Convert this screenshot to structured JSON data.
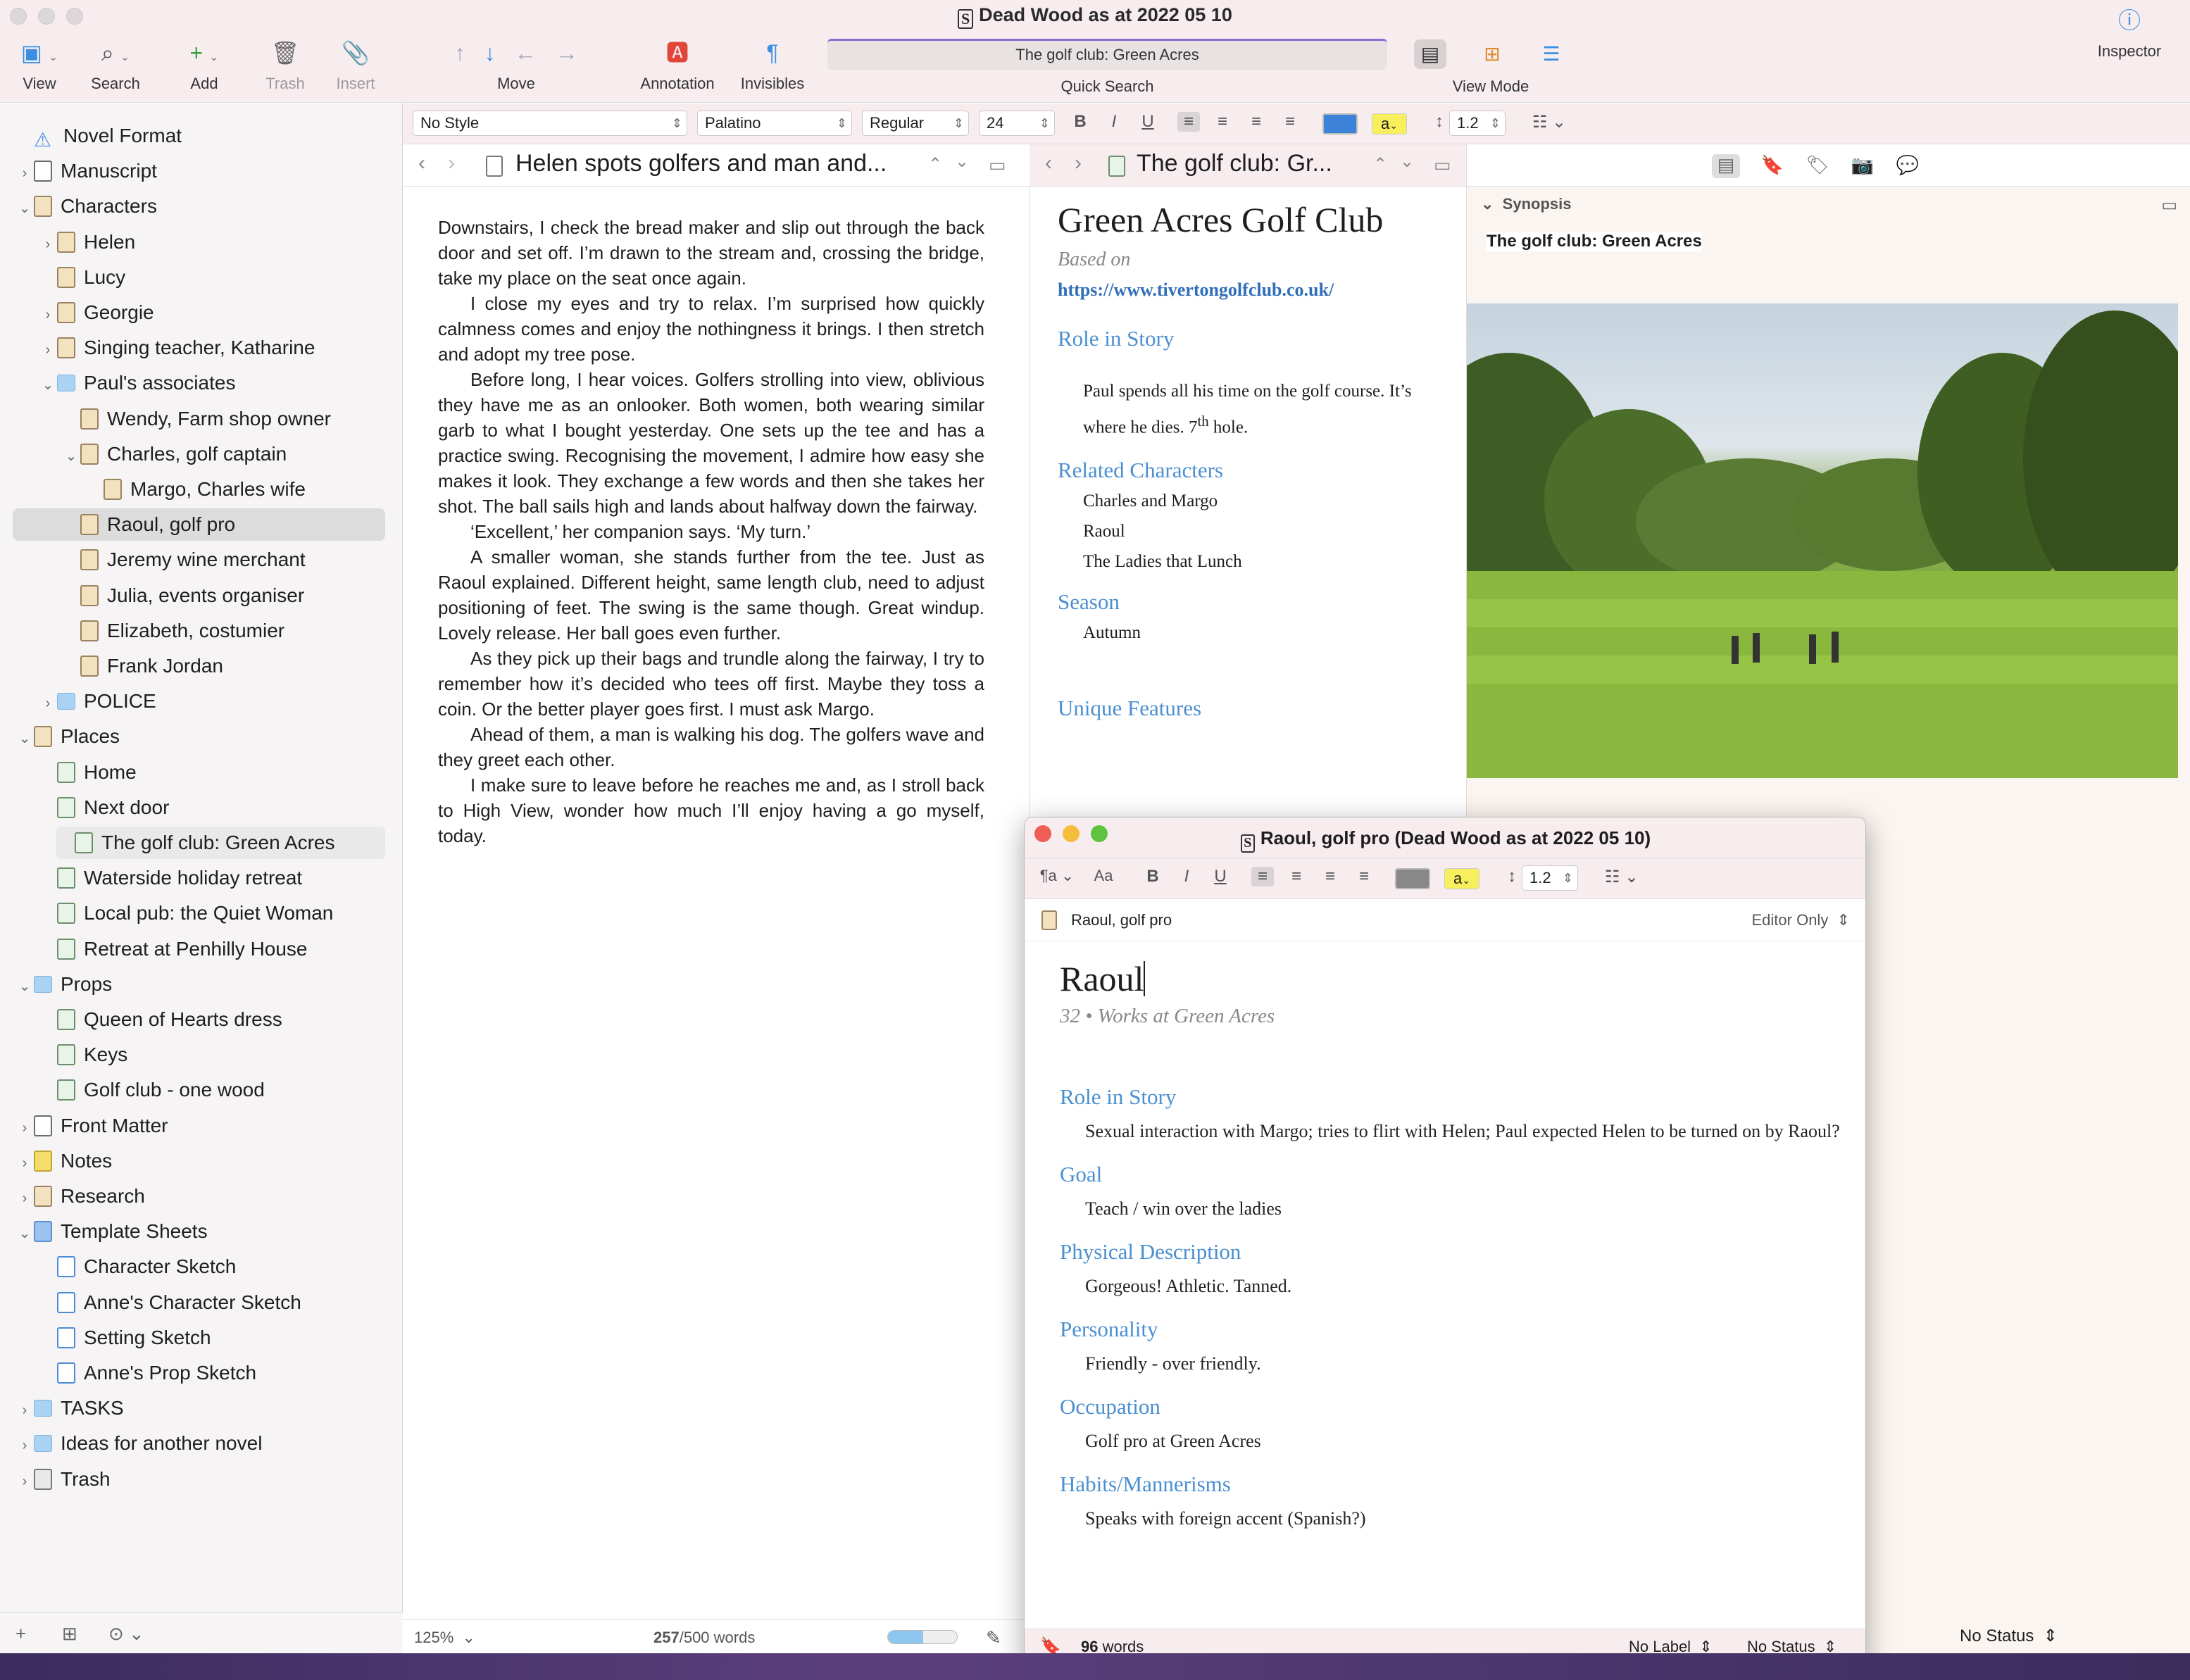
{
  "window": {
    "title": "Dead Wood as at 2022 05 10"
  },
  "toolbar": {
    "view": "View",
    "search": "Search",
    "add": "Add",
    "trash": "Trash",
    "insert": "Insert",
    "move": "Move",
    "annotation": "Annotation",
    "invisibles": "Invisibles",
    "quick_search_value": "The golf club: Green Acres",
    "quick_search_label": "Quick Search",
    "view_mode": "View Mode",
    "inspector": "Inspector"
  },
  "format": {
    "style": "No Style",
    "font": "Palatino",
    "weight": "Regular",
    "size": "24",
    "line_spacing": "1.2",
    "highlight": "a",
    "text_color": "#3b82d8"
  },
  "binder": {
    "items": [
      {
        "label": "Novel Format",
        "depth": 0,
        "icon": "warn",
        "disc": ""
      },
      {
        "label": "Manuscript",
        "depth": 0,
        "icon": "doc",
        "disc": "›"
      },
      {
        "label": "Characters",
        "depth": 0,
        "icon": "card",
        "disc": "⌄"
      },
      {
        "label": "Helen",
        "depth": 1,
        "icon": "card",
        "disc": "›"
      },
      {
        "label": "Lucy",
        "depth": 1,
        "icon": "card",
        "disc": ""
      },
      {
        "label": "Georgie",
        "depth": 1,
        "icon": "card",
        "disc": "›"
      },
      {
        "label": "Singing teacher, Katharine",
        "depth": 1,
        "icon": "card",
        "disc": "›"
      },
      {
        "label": "Paul's associates",
        "depth": 1,
        "icon": "folder",
        "disc": "⌄"
      },
      {
        "label": "Wendy, Farm shop owner",
        "depth": 2,
        "icon": "card",
        "disc": ""
      },
      {
        "label": "Charles, golf captain",
        "depth": 2,
        "icon": "card",
        "disc": "⌄"
      },
      {
        "label": "Margo, Charles wife",
        "depth": 3,
        "icon": "card",
        "disc": ""
      },
      {
        "label": "Raoul, golf pro",
        "depth": 2,
        "icon": "card",
        "disc": "",
        "selected": true
      },
      {
        "label": "Jeremy wine merchant",
        "depth": 2,
        "icon": "card",
        "disc": ""
      },
      {
        "label": "Julia, events organiser",
        "depth": 2,
        "icon": "card",
        "disc": ""
      },
      {
        "label": "Elizabeth, costumier",
        "depth": 2,
        "icon": "card",
        "disc": ""
      },
      {
        "label": "Frank Jordan",
        "depth": 2,
        "icon": "card",
        "disc": ""
      },
      {
        "label": "POLICE",
        "depth": 1,
        "icon": "folder",
        "disc": "›"
      },
      {
        "label": "Places",
        "depth": 0,
        "icon": "card",
        "disc": "⌄"
      },
      {
        "label": "Home",
        "depth": 1,
        "icon": "page",
        "disc": ""
      },
      {
        "label": "Next door",
        "depth": 1,
        "icon": "page",
        "disc": ""
      },
      {
        "label": "The golf club: Green Acres",
        "depth": 1,
        "icon": "page",
        "disc": "",
        "selected2": true
      },
      {
        "label": "Waterside holiday retreat",
        "depth": 1,
        "icon": "page",
        "disc": ""
      },
      {
        "label": "Local pub: the Quiet Woman",
        "depth": 1,
        "icon": "page",
        "disc": ""
      },
      {
        "label": "Retreat at Penhilly House",
        "depth": 1,
        "icon": "page",
        "disc": ""
      },
      {
        "label": "Props",
        "depth": 0,
        "icon": "folder",
        "disc": "⌄"
      },
      {
        "label": "Queen of Hearts dress",
        "depth": 1,
        "icon": "page",
        "disc": ""
      },
      {
        "label": "Keys",
        "depth": 1,
        "icon": "page",
        "disc": ""
      },
      {
        "label": "Golf club - one wood",
        "depth": 1,
        "icon": "page",
        "disc": ""
      },
      {
        "label": "Front Matter",
        "depth": 0,
        "icon": "doc",
        "disc": "›"
      },
      {
        "label": "Notes",
        "depth": 0,
        "icon": "notes",
        "disc": "›"
      },
      {
        "label": "Research",
        "depth": 0,
        "icon": "card",
        "disc": "›"
      },
      {
        "label": "Template Sheets",
        "depth": 0,
        "icon": "tmpl",
        "disc": "⌄"
      },
      {
        "label": "Character Sketch",
        "depth": 1,
        "icon": "sheet",
        "disc": ""
      },
      {
        "label": "Anne's Character Sketch",
        "depth": 1,
        "icon": "sheet",
        "disc": ""
      },
      {
        "label": "Setting Sketch",
        "depth": 1,
        "icon": "sheet",
        "disc": ""
      },
      {
        "label": "Anne's Prop Sketch",
        "depth": 1,
        "icon": "sheet",
        "disc": ""
      },
      {
        "label": "TASKS",
        "depth": 0,
        "icon": "folder",
        "disc": "›"
      },
      {
        "label": "Ideas for another novel",
        "depth": 0,
        "icon": "folder",
        "disc": "›"
      },
      {
        "label": "Trash",
        "depth": 0,
        "icon": "trash",
        "disc": "›"
      }
    ]
  },
  "editor1": {
    "title": "Helen spots golfers and man and...",
    "paragraphs": [
      "Downstairs, I check the bread maker and slip out through the back door and set off. I’m drawn to the stream and, crossing the bridge, take my place on the seat once again.",
      "I close my eyes and try to relax. I’m surprised how quickly calmness comes and enjoy the nothingness it brings. I then stretch and adopt my tree pose.",
      "Before long, I hear voices. Golfers strolling into view, oblivious they have me as an onlooker. Both women, both wearing similar garb to what I bought yesterday. One sets up the tee and has a practice swing. Recognising the movement, I admire how easy she makes it look. They exchange a few words and then she takes her shot. The ball sails high and lands about halfway down the fairway.",
      "‘Excellent,’ her companion says. ‘My turn.’",
      "A smaller woman, she stands further from the tee. Just as Raoul explained. Different height, same length club, need to adjust positioning of feet. The swing is the same though. Great windup. Lovely release. Her ball goes even further.",
      "As they pick up their bags and trundle along the fairway, I try to remember how it’s decided who tees off first. Maybe they toss a coin. Or the better player goes first. I must ask Margo.",
      "Ahead of them, a man is walking his dog. The golfers wave and they greet each other.",
      "I make sure to leave before he reaches me and, as I stroll back to High View, wonder how much I’ll enjoy having a go myself, today."
    ],
    "zoom": "125%",
    "word_count": "257",
    "word_target": "/500 words",
    "target_progress": 0.51
  },
  "editor2": {
    "tab_title": "The golf club: Gr...",
    "heading": "Green Acres Golf Club",
    "based_on": "Based on",
    "link": "https://www.tivertongolfclub.co.uk/",
    "sections": {
      "role_title": "Role in Story",
      "role_text": "Paul spends all his time on the golf course. It’s where he dies. 7",
      "role_sup": "th",
      "role_end": " hole.",
      "related_title": "Related Characters",
      "related": [
        "Charles and Margo",
        "Raoul",
        "The Ladies that Lunch"
      ],
      "season_title": "Season",
      "season": "Autumn",
      "unique_title": "Unique Features"
    }
  },
  "inspector": {
    "synopsis_label": "Synopsis",
    "synopsis_title": "The golf club: Green Acres",
    "image_desc": "golf-course-fairway-photo",
    "status": "No Status"
  },
  "quickref": {
    "title": "Raoul, golf pro (Dead Wood as at 2022 05 10)",
    "doc_name": "Raoul, golf pro",
    "mode": "Editor Only",
    "line_spacing": "1.2",
    "highlight": "a",
    "heading": "Raoul",
    "subtitle": "32 • Works at Green Acres",
    "sections": [
      {
        "title": "Role in Story",
        "text": "Sexual interaction with Margo; tries to flirt with Helen; Paul expected Helen to be turned on by Raoul?"
      },
      {
        "title": "Goal",
        "text": "Teach / win over the ladies"
      },
      {
        "title": "Physical Description",
        "text": "Gorgeous! Athletic. Tanned."
      },
      {
        "title": "Personality",
        "text": "Friendly - over friendly."
      },
      {
        "title": "Occupation",
        "text": "Golf pro at Green Acres"
      },
      {
        "title": "Habits/Mannerisms",
        "text": "Speaks with foreign accent (Spanish?)"
      }
    ],
    "word_count": "96",
    "words_label": "words",
    "label": "No Label",
    "status": "No Status"
  }
}
